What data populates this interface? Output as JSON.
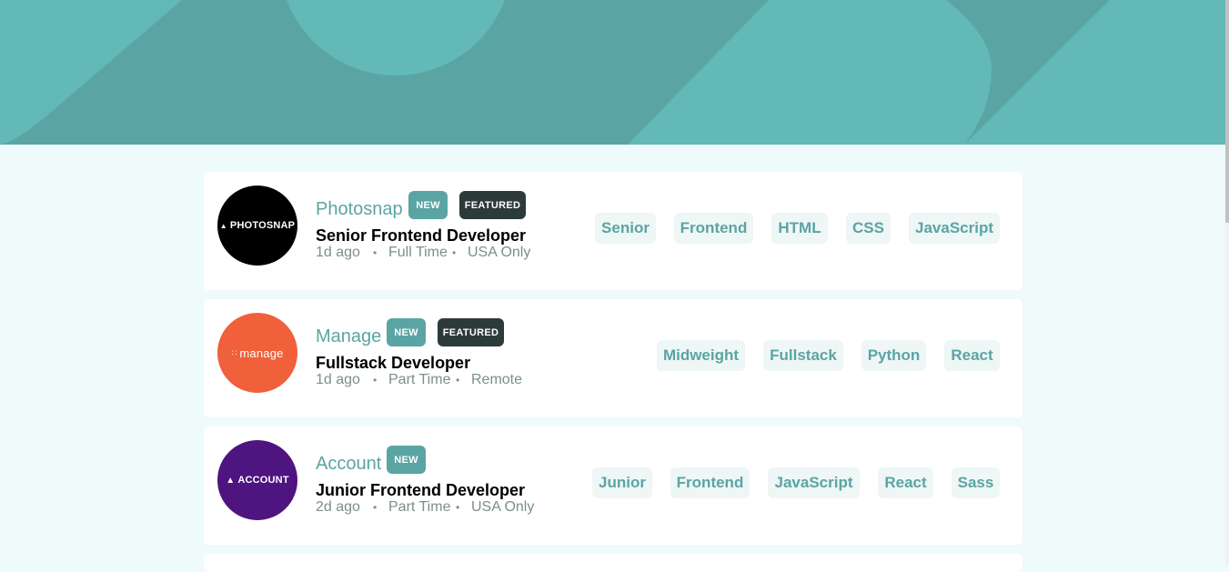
{
  "colors": {
    "accent": "#5ba4a4",
    "dark": "#2c3a3a",
    "page_bg": "#effafa",
    "tag_bg": "#eef6f6",
    "meta_text": "#7b8e8e"
  },
  "jobs": [
    {
      "logo_text": "PHOTOSNAP",
      "logo_color": "#000000",
      "logo_icon": "photosnap-logo-icon",
      "company": "Photosnap",
      "new_label": "NEW",
      "featured_label": "FEATURED",
      "position": "Senior Frontend Developer",
      "posted": "1d ago",
      "contract": "Full Time",
      "location": "USA Only",
      "tags": [
        "Senior",
        "Frontend",
        "HTML",
        "CSS",
        "JavaScript"
      ]
    },
    {
      "logo_text": "manage",
      "logo_color": "#f0603a",
      "logo_icon": "manage-logo-icon",
      "company": "Manage",
      "new_label": "NEW",
      "featured_label": "FEATURED",
      "position": "Fullstack Developer",
      "posted": "1d ago",
      "contract": "Part Time",
      "location": "Remote",
      "tags": [
        "Midweight",
        "Fullstack",
        "Python",
        "React"
      ]
    },
    {
      "logo_text": "ACCOUNT",
      "logo_color": "#4e147f",
      "logo_icon": "account-logo-icon",
      "company": "Account",
      "new_label": "NEW",
      "position": "Junior Frontend Developer",
      "posted": "2d ago",
      "contract": "Part Time",
      "location": "USA Only",
      "tags": [
        "Junior",
        "Frontend",
        "JavaScript",
        "React",
        "Sass"
      ]
    }
  ]
}
